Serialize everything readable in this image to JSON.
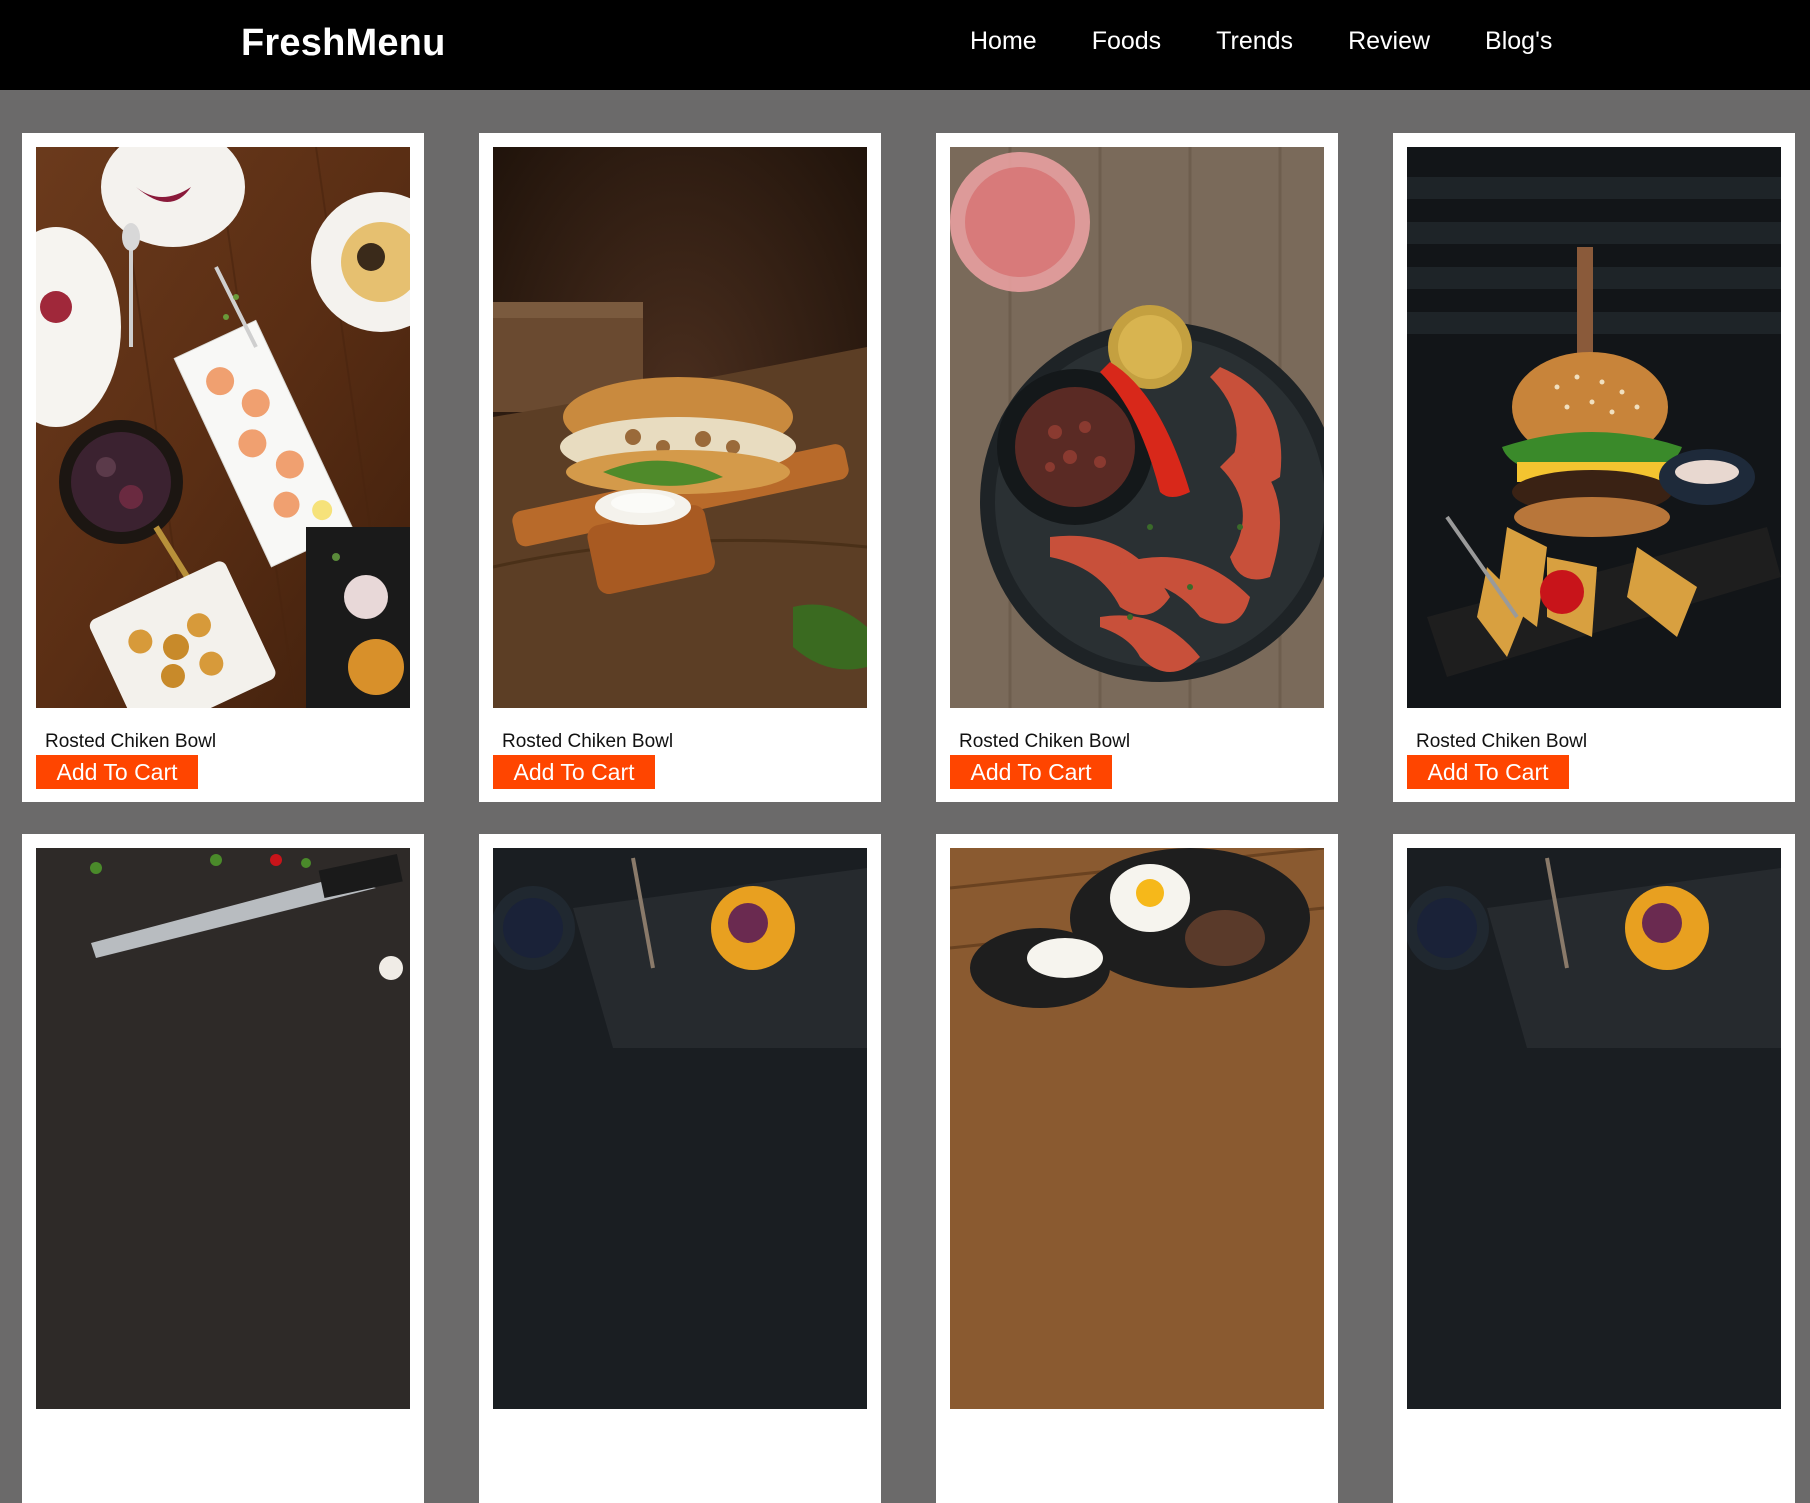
{
  "header": {
    "brand": "FreshMenu",
    "nav": [
      "Home",
      "Foods",
      "Trends",
      "Review",
      "Blog's"
    ]
  },
  "products": [
    {
      "name": "Rosted Chiken Bowl",
      "button": "Add To Cart",
      "image": "table-spread"
    },
    {
      "name": "Rosted Chiken Bowl",
      "button": "Add To Cart",
      "image": "sandwich"
    },
    {
      "name": "Rosted Chiken Bowl",
      "button": "Add To Cart",
      "image": "shrimp-plate"
    },
    {
      "name": "Rosted Chiken Bowl",
      "button": "Add To Cart",
      "image": "burger"
    },
    {
      "name": "",
      "button": "",
      "image": "knife"
    },
    {
      "name": "",
      "button": "",
      "image": "smoothie-tray"
    },
    {
      "name": "",
      "button": "",
      "image": "egg-skillet"
    },
    {
      "name": "",
      "button": "",
      "image": "smoothie-tray"
    }
  ],
  "colors": {
    "header_bg": "#000000",
    "page_bg": "#6b6a6a",
    "card_bg": "#ffffff",
    "accent": "#ff4500"
  }
}
